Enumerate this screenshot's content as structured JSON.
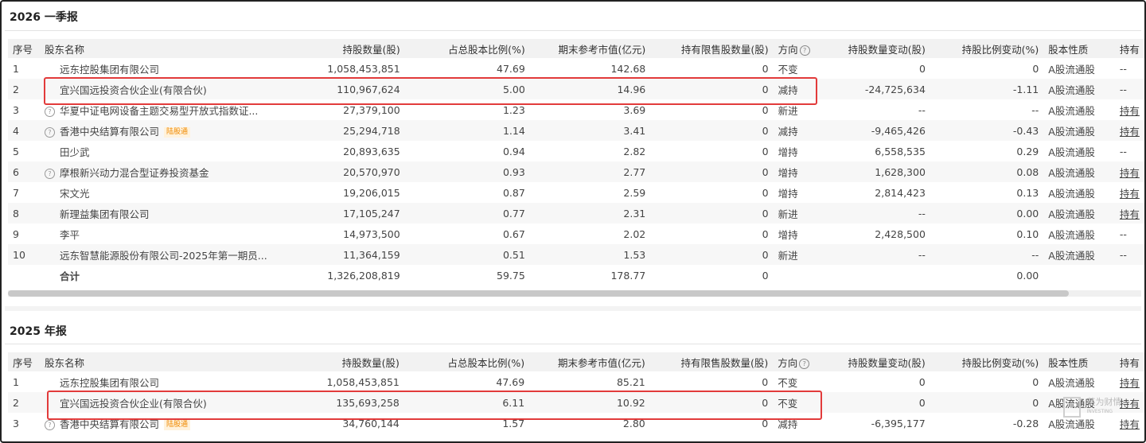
{
  "sections": [
    {
      "title": "2026 一季报",
      "columns": [
        "序号",
        "股东名称",
        "持股数量(股)",
        "占总股本比例(%)",
        "期末参考市值(亿元)",
        "持有限售股数量(股)",
        "方向",
        "持股数量变动(股)",
        "持股比例变动(%)",
        "股本性质",
        "持有"
      ],
      "rows": [
        {
          "no": "1",
          "name": "远东控股集团有限公司",
          "shares": "1,058,453,851",
          "pct": "47.69",
          "value": "142.68",
          "restricted": "0",
          "direction": "不变",
          "change": "0",
          "pct_change": "0",
          "nature": "A股流通股",
          "hold": "--"
        },
        {
          "no": "2",
          "name": "宜兴国远投资合伙企业(有限合伙)",
          "shares": "110,967,624",
          "pct": "5.00",
          "value": "14.96",
          "restricted": "0",
          "direction": "减持",
          "change": "-24,725,634",
          "pct_change": "-1.11",
          "nature": "A股流通股",
          "hold": "--"
        },
        {
          "no": "3",
          "name": "华夏中证电网设备主题交易型开放式指数证...",
          "shares": "27,379,100",
          "pct": "1.23",
          "value": "3.69",
          "restricted": "0",
          "direction": "新进",
          "change": "--",
          "pct_change": "--",
          "nature": "A股流通股",
          "hold": "持有"
        },
        {
          "no": "4",
          "name": "香港中央结算有限公司",
          "tag": "陆股通",
          "shares": "25,294,718",
          "pct": "1.14",
          "value": "3.41",
          "restricted": "0",
          "direction": "减持",
          "change": "-9,465,426",
          "pct_change": "-0.43",
          "nature": "A股流通股",
          "hold": "持有"
        },
        {
          "no": "5",
          "name": "田少武",
          "shares": "20,893,635",
          "pct": "0.94",
          "value": "2.82",
          "restricted": "0",
          "direction": "增持",
          "change": "6,558,535",
          "pct_change": "0.29",
          "nature": "A股流通股",
          "hold": "--"
        },
        {
          "no": "6",
          "name": "摩根新兴动力混合型证券投资基金",
          "shares": "20,570,970",
          "pct": "0.93",
          "value": "2.77",
          "restricted": "0",
          "direction": "增持",
          "change": "1,628,300",
          "pct_change": "0.08",
          "nature": "A股流通股",
          "hold": "持有"
        },
        {
          "no": "7",
          "name": "宋文光",
          "shares": "19,206,015",
          "pct": "0.87",
          "value": "2.59",
          "restricted": "0",
          "direction": "增持",
          "change": "2,814,423",
          "pct_change": "0.13",
          "nature": "A股流通股",
          "hold": "持有"
        },
        {
          "no": "8",
          "name": "新理益集团有限公司",
          "shares": "17,105,247",
          "pct": "0.77",
          "value": "2.31",
          "restricted": "0",
          "direction": "新进",
          "change": "--",
          "pct_change": "0.00",
          "nature": "A股流通股",
          "hold": "持有"
        },
        {
          "no": "9",
          "name": "李平",
          "shares": "14,973,500",
          "pct": "0.67",
          "value": "2.02",
          "restricted": "0",
          "direction": "增持",
          "change": "2,428,500",
          "pct_change": "0.10",
          "nature": "A股流通股",
          "hold": "--"
        },
        {
          "no": "10",
          "name": "远东智慧能源股份有限公司-2025年第一期员...",
          "shares": "11,364,159",
          "pct": "0.51",
          "value": "1.53",
          "restricted": "0",
          "direction": "新进",
          "change": "--",
          "pct_change": "--",
          "nature": "A股流通股",
          "hold": "--"
        }
      ],
      "total": {
        "label": "合计",
        "shares": "1,326,208,819",
        "pct": "59.75",
        "value": "178.77",
        "restricted": "0",
        "pct_change": "0.00"
      }
    },
    {
      "title": "2025 年报",
      "columns": [
        "序号",
        "股东名称",
        "持股数量(股)",
        "占总股本比例(%)",
        "期末参考市值(亿元)",
        "持有限售股数量(股)",
        "方向",
        "持股数量变动(股)",
        "持股比例变动(%)",
        "股本性质",
        "持有"
      ],
      "rows": [
        {
          "no": "1",
          "name": "远东控股集团有限公司",
          "shares": "1,058,453,851",
          "pct": "47.69",
          "value": "85.21",
          "restricted": "0",
          "direction": "不变",
          "change": "0",
          "pct_change": "0",
          "nature": "A股流通股",
          "hold": "持有"
        },
        {
          "no": "2",
          "name": "宜兴国远投资合伙企业(有限合伙)",
          "shares": "135,693,258",
          "pct": "6.11",
          "value": "10.92",
          "restricted": "0",
          "direction": "不变",
          "change": "0",
          "pct_change": "0",
          "nature": "A股流通股",
          "hold": "持有"
        },
        {
          "no": "3",
          "name": "香港中央结算有限公司",
          "tag": "陆股通",
          "shares": "34,760,144",
          "pct": "1.57",
          "value": "2.80",
          "restricted": "0",
          "direction": "减持",
          "change": "-6,395,177",
          "pct_change": "-0.28",
          "nature": "A股流通股",
          "hold": "持有"
        }
      ]
    }
  ],
  "watermark": {
    "text": "英为财情",
    "sub": "INVESTING"
  },
  "colors": {
    "highlight": "#e23b3b",
    "decrease": "#2aa84a",
    "increase": "#e03a3a",
    "new": "#f08a00"
  }
}
